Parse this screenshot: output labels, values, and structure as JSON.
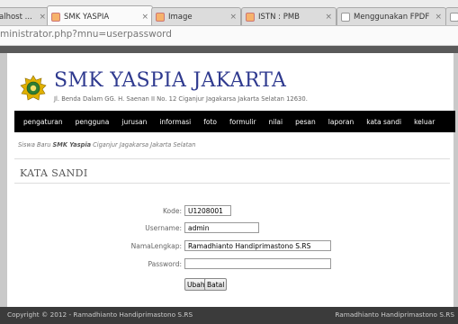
{
  "browser": {
    "tabs": [
      {
        "label": "alhost ...",
        "close": "×"
      },
      {
        "label": "SMK YASPIA",
        "close": "×"
      },
      {
        "label": "Image",
        "close": "×"
      },
      {
        "label": "ISTN : PMB",
        "close": "×"
      },
      {
        "label": "Menggunakan FPDF ...",
        "close": "×"
      },
      {
        "label": "",
        "close": ""
      }
    ],
    "url": "ministrator.php?mnu=userpassword"
  },
  "header": {
    "title": "SMK YASPIA JAKARTA",
    "address": "Jl. Benda Dalam GG. H. Saenan II No. 12 Ciganjur Jagakarsa Jakarta Selatan 12630."
  },
  "nav": [
    "pengaturan",
    "pengguna",
    "jurusan",
    "informasi",
    "foto",
    "formulir",
    "nilai",
    "pesan",
    "laporan",
    "kata sandi",
    "keluar"
  ],
  "breadcrumb": {
    "prefix": "Siswa Baru ",
    "bold": "SMK Yaspia",
    "suffix": " Ciganjur Jagakarsa Jakarta Selatan"
  },
  "section_title": "KATA SANDI",
  "form": {
    "kode_label": "Kode:",
    "kode_value": "U1208001",
    "username_label": "Username:",
    "username_value": "admin",
    "namalengkap_label": "NamaLengkap:",
    "namalengkap_value": "Ramadhianto Handiprimastono S.RS",
    "password_label": "Password:",
    "password_value": "",
    "ubah_label": "Ubah",
    "batal_label": "Batal"
  },
  "footer": {
    "left": "Copyright © 2012 - Ramadhianto Handiprimastono S.RS",
    "right": "Ramadhianto Handiprimastono S.RS"
  },
  "colors": {
    "title": "#2f3a8f",
    "nav_bg": "#000000",
    "footer_bg": "#3b3b3b"
  }
}
